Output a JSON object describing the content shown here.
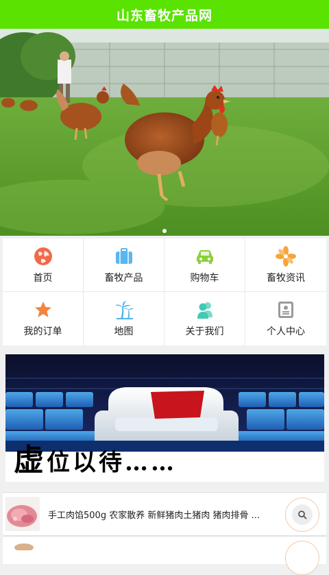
{
  "header": {
    "title": "山东畜牧产品网"
  },
  "banner": {
    "slides": 1,
    "active_slide": 1
  },
  "menu": {
    "items": [
      {
        "label": "首页",
        "icon": "globe-icon",
        "color": "#f06a4a"
      },
      {
        "label": "畜牧产品",
        "icon": "suitcase-icon",
        "color": "#5bb6f0"
      },
      {
        "label": "购物车",
        "icon": "car-icon",
        "color": "#8ccf3a"
      },
      {
        "label": "畜牧资讯",
        "icon": "flower-icon",
        "color": "#f6a53c"
      },
      {
        "label": "我的订单",
        "icon": "star-icon",
        "color": "#f3853e"
      },
      {
        "label": "地图",
        "icon": "palm-tree-icon",
        "color": "#4fb3e6"
      },
      {
        "label": "关于我们",
        "icon": "people-icon",
        "color": "#43c9b4"
      },
      {
        "label": "个人中心",
        "icon": "id-card-icon",
        "color": "#9a9a9a"
      }
    ]
  },
  "ad": {
    "text_big": "虚",
    "text_rest": "位以待……"
  },
  "products": [
    {
      "title": "手工肉馅500g 农家散养 新鲜猪肉土猪肉 猪肉排骨 ...",
      "search_icon": "search-icon"
    }
  ],
  "colors": {
    "header_bg": "#5ae300",
    "background": "#f0f0f0"
  }
}
